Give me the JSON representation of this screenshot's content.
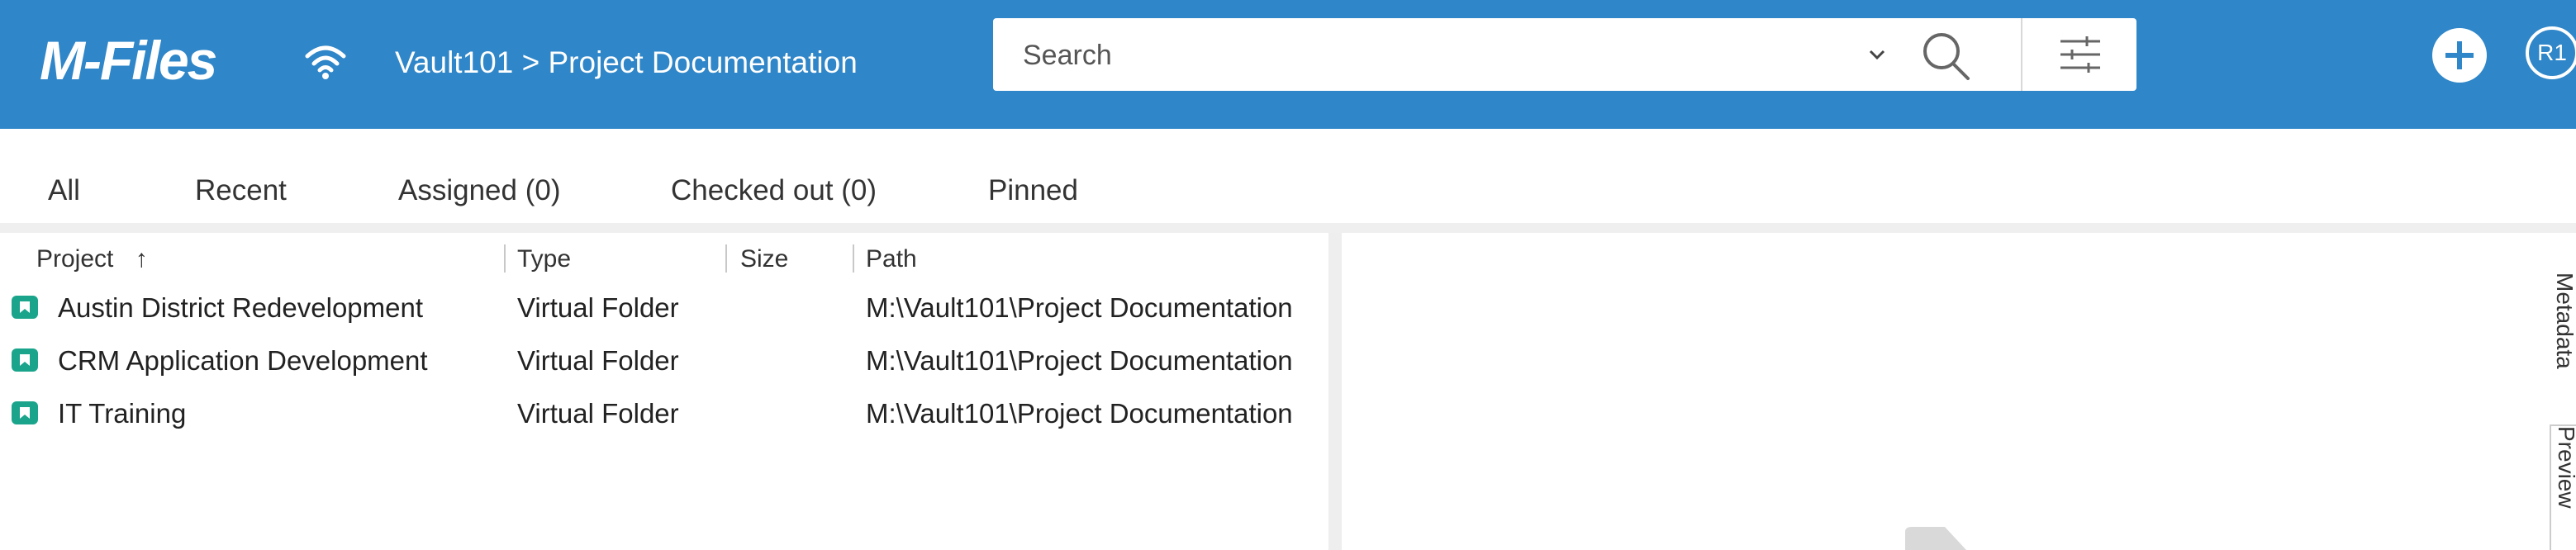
{
  "app": {
    "logo": "M-Files"
  },
  "header": {
    "breadcrumb": "Vault101 > Project Documentation",
    "search_placeholder": "Search",
    "avatar_initials": "R1"
  },
  "tabs": [
    {
      "label": "All"
    },
    {
      "label": "Recent"
    },
    {
      "label": "Assigned (0)"
    },
    {
      "label": "Checked out (0)"
    },
    {
      "label": "Pinned"
    }
  ],
  "list": {
    "columns": {
      "project": "Project",
      "sort_indicator": "↑",
      "type": "Type",
      "size": "Size",
      "path": "Path"
    },
    "rows": [
      {
        "name": "Austin District Redevelopment",
        "type": "Virtual Folder",
        "size": "",
        "path": "M:\\Vault101\\Project Documentation"
      },
      {
        "name": "CRM Application Development",
        "type": "Virtual Folder",
        "size": "",
        "path": "M:\\Vault101\\Project Documentation"
      },
      {
        "name": "IT Training",
        "type": "Virtual Folder",
        "size": "",
        "path": "M:\\Vault101\\Project Documentation"
      }
    ]
  },
  "side_tabs": {
    "metadata": "Metadata",
    "preview": "Preview"
  },
  "icons": {
    "connection": "wifi-icon",
    "search_dropdown": "chevron-down-icon",
    "search": "search-icon",
    "filter": "filter-icon",
    "add": "plus-circle-icon",
    "row": "folder-icon"
  },
  "colors": {
    "brand_blue": "#2f86c8",
    "folder_teal": "#1aa48b"
  }
}
